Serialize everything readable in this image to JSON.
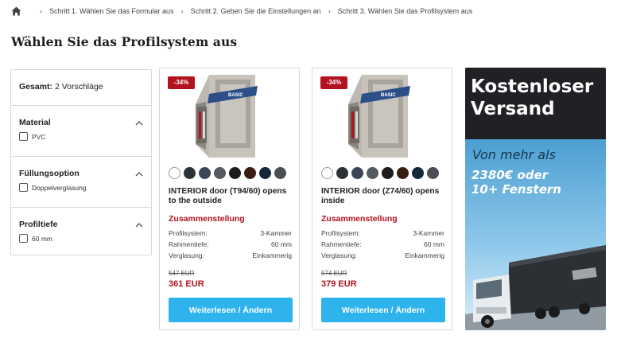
{
  "breadcrumb": {
    "items": [
      "Schritt 1. Wählen Sie das Formular aus",
      "Schritt 2. Geben Sie die Einstellungen an",
      "Schritt 3. Wählen Sie das Profilsystem aus"
    ]
  },
  "page": {
    "title": "Wählen Sie das Profilsystem aus"
  },
  "filters": {
    "total_label": "Gesamt:",
    "total_value": "2 Vorschläge",
    "groups": [
      {
        "title": "Material",
        "option": "PVC"
      },
      {
        "title": "Füllungsoption",
        "option": "Doppelverglasung"
      },
      {
        "title": "Profiltiefe",
        "option": "60 mm"
      }
    ]
  },
  "products": [
    {
      "discount": "-34%",
      "badge": "BASIC",
      "title": "INTERIOR door (T94/60) opens to the outside",
      "section": "Zusammenstellung",
      "specs": [
        {
          "label": "Profilsystem:",
          "value": "3-Kammer"
        },
        {
          "label": "Rahmentiefe:",
          "value": "60 mm"
        },
        {
          "label": "Verglasung:",
          "value": "Einkammerig"
        }
      ],
      "old_price": "547 EUR",
      "price": "361 EUR",
      "button": "Weiterlesen / Ändern"
    },
    {
      "discount": "-34%",
      "badge": "BASIC",
      "title": "INTERIOR door (Z74/60) opens inside",
      "section": "Zusammenstellung",
      "specs": [
        {
          "label": "Profilsystem:",
          "value": "3-Kammer"
        },
        {
          "label": "Rahmentiefe:",
          "value": "60 mm"
        },
        {
          "label": "Verglasung:",
          "value": "Einkammerig"
        }
      ],
      "old_price": "574 EUR",
      "price": "379 EUR",
      "button": "Weiterlesen / Ändern"
    }
  ],
  "swatch_colors": [
    "#ffffff",
    "#2b2f36",
    "#3a4658",
    "#555a5f",
    "#1c1c1c",
    "#3a1d12",
    "#15273a",
    "#4b4e52"
  ],
  "ad": {
    "headline_1": "Kostenloser",
    "headline_2": "Versand",
    "line_1": "Von mehr als",
    "line_2": "2380€ oder",
    "line_3": "10+ Fenstern"
  },
  "colors": {
    "accent_red": "#b3121f",
    "button_blue": "#2fb3ec",
    "border": "#d7d7d7"
  }
}
